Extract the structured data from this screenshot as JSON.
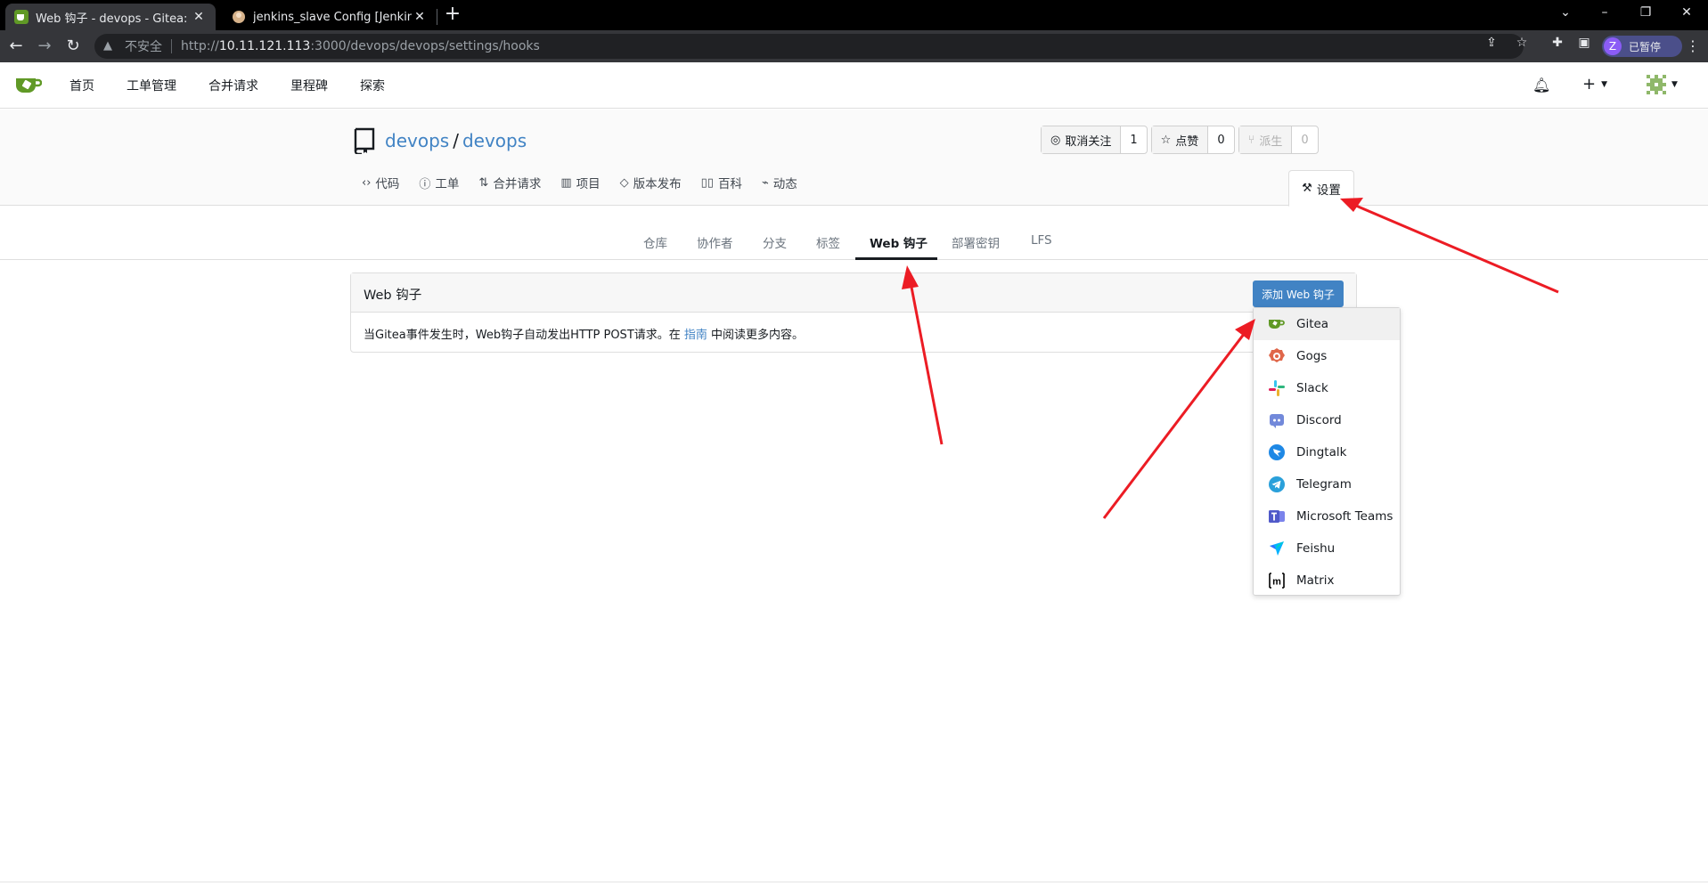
{
  "browser": {
    "tabs": [
      {
        "title": "Web 钩子 - devops - Gitea: Git",
        "close": "✕"
      },
      {
        "title": "jenkins_slave Config [Jenkins]",
        "close": "✕"
      }
    ],
    "insecure_label": "不安全",
    "url_host": "http://10.11.121.113",
    "url_host_bold": "10.11.121.113",
    "url_prefix": "http://",
    "url_rest": ":3000/devops/devops/settings/hooks",
    "profile_initial": "Z",
    "profile_label": "已暂停"
  },
  "gitea_nav": {
    "items": [
      "首页",
      "工单管理",
      "合并请求",
      "里程碑",
      "探索"
    ]
  },
  "repo": {
    "owner": "devops",
    "name": "devops",
    "watch": {
      "label": "取消关注",
      "count": "1"
    },
    "star": {
      "label": "点赞",
      "count": "0"
    },
    "fork": {
      "label": "派生",
      "count": "0"
    },
    "tabs": [
      {
        "label": "代码",
        "icon": "code-icon"
      },
      {
        "label": "工单",
        "icon": "issue-icon"
      },
      {
        "label": "合并请求",
        "icon": "pull-request-icon"
      },
      {
        "label": "项目",
        "icon": "project-icon"
      },
      {
        "label": "版本发布",
        "icon": "tag-icon"
      },
      {
        "label": "百科",
        "icon": "book-icon"
      },
      {
        "label": "动态",
        "icon": "pulse-icon"
      }
    ],
    "settings_label": "设置"
  },
  "settings_nav": {
    "items": [
      "仓库",
      "协作者",
      "分支",
      "标签",
      "Web 钩子",
      "部署密钥",
      "LFS"
    ],
    "active": "Web 钩子"
  },
  "webhooks": {
    "title": "Web 钩子",
    "add_button": "添加 Web 钩子",
    "desc_before": "当Gitea事件发生时，Web钩子自动发出HTTP POST请求。在 ",
    "desc_link": "指南",
    "desc_after": " 中阅读更多内容。"
  },
  "dropdown": {
    "items": [
      {
        "label": "Gitea",
        "icon": "gitea-icon",
        "color": "#609926"
      },
      {
        "label": "Gogs",
        "icon": "gogs-icon",
        "color": "#e0674a"
      },
      {
        "label": "Slack",
        "icon": "slack-icon",
        "color": "#36c5f0"
      },
      {
        "label": "Discord",
        "icon": "discord-icon",
        "color": "#7289da"
      },
      {
        "label": "Dingtalk",
        "icon": "dingtalk-icon",
        "color": "#1e88e5"
      },
      {
        "label": "Telegram",
        "icon": "telegram-icon",
        "color": "#2aa0da"
      },
      {
        "label": "Microsoft Teams",
        "icon": "teams-icon",
        "color": "#5059c9"
      },
      {
        "label": "Feishu",
        "icon": "feishu-icon",
        "color": "#00b2ff"
      },
      {
        "label": "Matrix",
        "icon": "matrix-icon",
        "color": "#000000"
      }
    ]
  },
  "colors": {
    "accent": "#4183c4",
    "annotation_arrow": "#ec1c24"
  }
}
